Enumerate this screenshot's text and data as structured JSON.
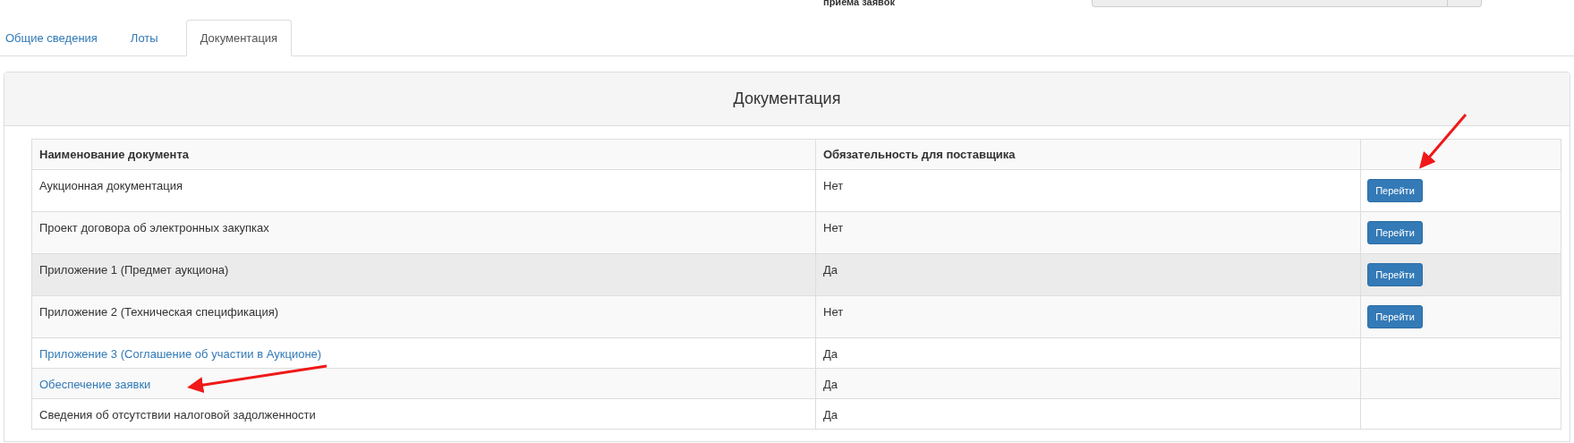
{
  "top_field": {
    "label": "приема заявок"
  },
  "tabs": [
    {
      "label": "Общие сведения",
      "selected": false
    },
    {
      "label": "Лоты",
      "selected": false
    },
    {
      "label": "Документация",
      "selected": true
    }
  ],
  "panel": {
    "title": "Документация"
  },
  "table": {
    "columns": [
      "Наименование документа",
      "Обязательность для поставщика"
    ],
    "rows": [
      {
        "name": "Аукционная документация",
        "link": false,
        "hovered": false,
        "required": "Нет",
        "button": "Перейти"
      },
      {
        "name": "Проект договора об электронных закупках",
        "link": false,
        "hovered": false,
        "required": "Нет",
        "button": "Перейти"
      },
      {
        "name": "Приложение 1 (Предмет аукциона)",
        "link": false,
        "hovered": true,
        "required": "Да",
        "button": "Перейти"
      },
      {
        "name": "Приложение 2 (Техническая спецификация)",
        "link": false,
        "hovered": false,
        "required": "Нет",
        "button": "Перейти"
      },
      {
        "name": "Приложение 3 (Соглашение об участии в Аукционе)",
        "link": true,
        "hovered": false,
        "required": "Да"
      },
      {
        "name": "Обеспечение заявки",
        "link": true,
        "hovered": false,
        "required": "Да"
      },
      {
        "name": "Сведения об отсутствии налоговой задолженности",
        "link": false,
        "hovered": false,
        "required": "Да"
      }
    ]
  }
}
